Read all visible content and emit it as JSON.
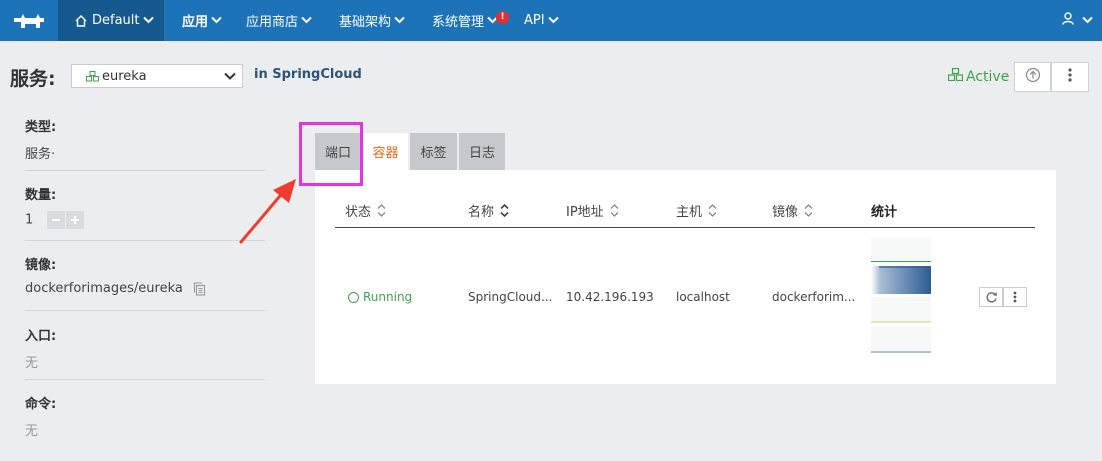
{
  "topbar": {
    "environment": "Default",
    "nav": [
      {
        "label": "应用",
        "active": true
      },
      {
        "label": "应用商店",
        "active": false
      },
      {
        "label": "基础架构",
        "active": false
      },
      {
        "label": "系统管理",
        "active": false,
        "alert": "!"
      },
      {
        "label": "API",
        "active": false
      }
    ]
  },
  "header": {
    "service_label": "服务:",
    "service_selected": "eureka",
    "stack_prefix": "in",
    "stack_name": "SpringCloud",
    "state": "Active"
  },
  "info": {
    "type_label": "类型:",
    "type_value": "服务·",
    "scale_label": "数量:",
    "scale_value": "1",
    "image_label": "镜像:",
    "image_value": "dockerforimages/eureka",
    "entry_label": "入口:",
    "entry_value": "无",
    "command_label": "命令:",
    "command_value": "无"
  },
  "tabs": [
    {
      "label": "端口",
      "active": false
    },
    {
      "label": "容器",
      "active": true
    },
    {
      "label": "标签",
      "active": false
    },
    {
      "label": "日志",
      "active": false
    }
  ],
  "table": {
    "headers": {
      "state": "状态",
      "name": "名称",
      "ip": "IP地址",
      "host": "主机",
      "image": "镜像",
      "stats": "统计"
    },
    "rows": [
      {
        "state": "Running",
        "name": "SpringCloud...",
        "ip": "10.42.196.193",
        "host": "localhost",
        "image": "dockerforim..."
      }
    ]
  },
  "colors": {
    "topbar": "#1d73b8",
    "env_bg": "#16598f",
    "active_state": "#3fa34d",
    "active_tab_text": "#e36d1f",
    "highlight": "#e235e2",
    "arrow": "#f23b2f"
  }
}
